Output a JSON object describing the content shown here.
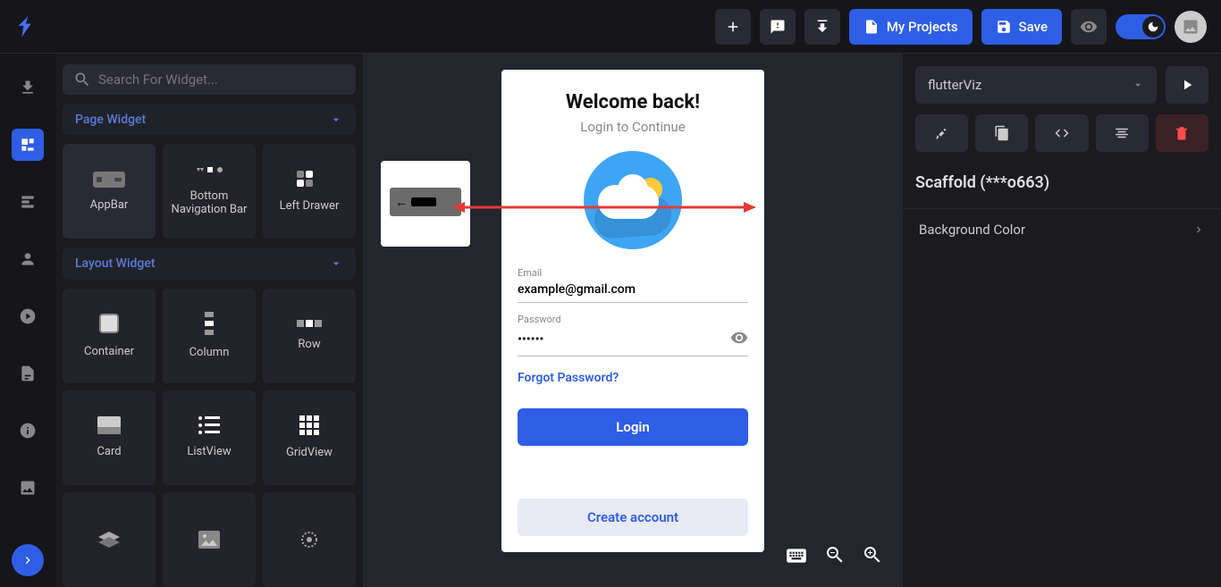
{
  "topbar": {
    "my_projects": "My Projects",
    "save": "Save"
  },
  "search": {
    "placeholder": "Search For Widget..."
  },
  "sections": {
    "page_widget": "Page Widget",
    "layout_widget": "Layout Widget"
  },
  "widgets": {
    "page": [
      "AppBar",
      "Bottom Navigation Bar",
      "Left Drawer"
    ],
    "layout": [
      "Container",
      "Column",
      "Row",
      "Card",
      "ListView",
      "GridView"
    ]
  },
  "device": {
    "title": "Welcome back!",
    "subtitle": "Login to Continue",
    "email_label": "Email",
    "email_value": "example@gmail.com",
    "password_label": "Password",
    "password_value": "••••••",
    "forgot": "Forgot Password?",
    "login": "Login",
    "create": "Create account"
  },
  "inspector": {
    "selected_item": "flutterViz",
    "scaffold_title": "Scaffold (***o663)",
    "bg_color": "Background Color"
  }
}
